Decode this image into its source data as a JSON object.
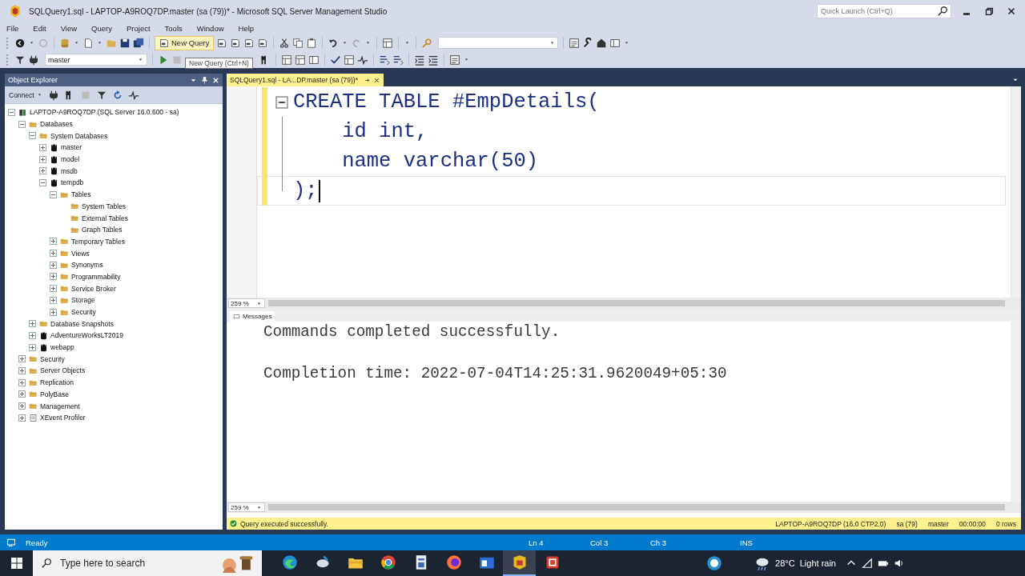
{
  "window": {
    "title": "SQLQuery1.sql - LAPTOP-A9ROQ7DP.master (sa (79))* - Microsoft SQL Server Management Studio",
    "quick_launch": {
      "placeholder": "Quick Launch (Ctrl+Q)"
    }
  },
  "menu": [
    "File",
    "Edit",
    "View",
    "Query",
    "Project",
    "Tools",
    "Window",
    "Help"
  ],
  "toolbar": {
    "new_query": "New Query",
    "database": "master",
    "tooltip": "New Query (Ctrl+N)"
  },
  "object_explorer": {
    "title": "Object Explorer",
    "connect": "Connect",
    "tree": [
      {
        "label": "LAPTOP-A9ROQ7DP (SQL Server 16.0.600 - sa)",
        "kind": "server",
        "expanded": true,
        "children": [
          {
            "label": "Databases",
            "kind": "folder",
            "expanded": true,
            "children": [
              {
                "label": "System Databases",
                "kind": "folder",
                "expanded": true,
                "children": [
                  {
                    "label": "master",
                    "kind": "database",
                    "expanded": false
                  },
                  {
                    "label": "model",
                    "kind": "database",
                    "expanded": false
                  },
                  {
                    "label": "msdb",
                    "kind": "database",
                    "expanded": false
                  },
                  {
                    "label": "tempdb",
                    "kind": "database",
                    "expanded": true,
                    "children": [
                      {
                        "label": "Tables",
                        "kind": "folder",
                        "expanded": true,
                        "children": [
                          {
                            "label": "System Tables",
                            "kind": "folder"
                          },
                          {
                            "label": "External Tables",
                            "kind": "folder"
                          },
                          {
                            "label": "Graph Tables",
                            "kind": "folder"
                          }
                        ]
                      },
                      {
                        "label": "Temporary Tables",
                        "kind": "folder",
                        "expanded": false
                      },
                      {
                        "label": "Views",
                        "kind": "folder",
                        "expanded": false
                      },
                      {
                        "label": "Synonyms",
                        "kind": "folder",
                        "expanded": false
                      },
                      {
                        "label": "Programmability",
                        "kind": "folder",
                        "expanded": false
                      },
                      {
                        "label": "Service Broker",
                        "kind": "folder",
                        "expanded": false
                      },
                      {
                        "label": "Storage",
                        "kind": "folder",
                        "expanded": false
                      },
                      {
                        "label": "Security",
                        "kind": "folder",
                        "expanded": false
                      }
                    ]
                  }
                ]
              },
              {
                "label": "Database Snapshots",
                "kind": "folder",
                "expanded": false
              },
              {
                "label": "AdventureWorksLT2019",
                "kind": "database",
                "expanded": false
              },
              {
                "label": "webapp",
                "kind": "database",
                "expanded": false
              }
            ]
          },
          {
            "label": "Security",
            "kind": "folder",
            "expanded": false
          },
          {
            "label": "Server Objects",
            "kind": "folder",
            "expanded": false
          },
          {
            "label": "Replication",
            "kind": "folder",
            "expanded": false
          },
          {
            "label": "PolyBase",
            "kind": "folder",
            "expanded": false
          },
          {
            "label": "Management",
            "kind": "folder",
            "expanded": false
          },
          {
            "label": "XEvent Profiler",
            "kind": "profiler",
            "expanded": false
          }
        ]
      }
    ]
  },
  "editor": {
    "tab": {
      "label": "SQLQuery1.sql - LA...DP.master (sa (79))*",
      "selected": true
    },
    "lines": [
      {
        "text": "CREATE TABLE #EmpDetails(",
        "changed": true,
        "current": false
      },
      {
        "text": "    id int,",
        "changed": true,
        "current": false
      },
      {
        "text": "    name varchar(50)",
        "changed": true,
        "current": false
      },
      {
        "text": ");",
        "changed": true,
        "current": true
      }
    ],
    "zoom": "259 %"
  },
  "results": {
    "tab": "Messages",
    "messages": [
      "Commands completed successfully.",
      "Completion time: 2022-07-04T14:25:31.9620049+05:30"
    ],
    "zoom": "259 %"
  },
  "query_status": {
    "message": "Query executed successfully.",
    "items": [
      "LAPTOP-A9ROQ7DP (16.0 CTP2.0)",
      "sa (79)",
      "master",
      "00:00:00",
      "0 rows"
    ]
  },
  "status_bar": {
    "state": "Ready",
    "items": [
      "Ln 4",
      "Col 3",
      "Ch 3",
      "INS"
    ]
  },
  "taskbar": {
    "search": {
      "placeholder": "Type here to search"
    },
    "weather": "28°C  Light rain"
  }
}
